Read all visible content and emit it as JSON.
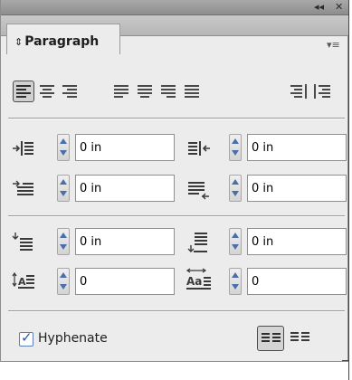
{
  "window": {
    "collapse_icon": "double-left-arrow-icon",
    "close_icon": "close-icon",
    "collapse_glyph": "◂◂",
    "close_glyph": "✕"
  },
  "tab": {
    "label": "Paragraph",
    "updown_glyph": "⇕",
    "menu_icon": "panel-menu-icon",
    "menu_glyph": "▾≡"
  },
  "alignment": {
    "buttons": [
      {
        "name": "align-left",
        "active": true
      },
      {
        "name": "align-center",
        "active": false
      },
      {
        "name": "align-right",
        "active": false
      },
      {
        "name": "justify-last-left",
        "active": false
      },
      {
        "name": "justify-last-center",
        "active": false
      },
      {
        "name": "justify-last-right",
        "active": false
      },
      {
        "name": "justify-all",
        "active": false
      },
      {
        "name": "align-toward-spine",
        "active": false
      },
      {
        "name": "align-away-from-spine",
        "active": false
      }
    ]
  },
  "indents": {
    "left_indent": "0 in",
    "right_indent": "0 in",
    "first_line_left_indent": "0 in",
    "last_line_right_indent": "0 in"
  },
  "spacing": {
    "space_before": "0 in",
    "space_after": "0 in",
    "drop_cap_lines": "0",
    "drop_cap_characters": "0"
  },
  "hyphenate": {
    "label": "Hyphenate",
    "checked": true,
    "check_glyph": "✓"
  },
  "composer": {
    "buttons": [
      {
        "name": "do-not-align-to-baseline-grid",
        "active": true
      },
      {
        "name": "align-to-baseline-grid",
        "active": false
      }
    ]
  },
  "colors": {
    "panel_bg": "#ececec",
    "accent_blue": "#4a6ea8"
  }
}
